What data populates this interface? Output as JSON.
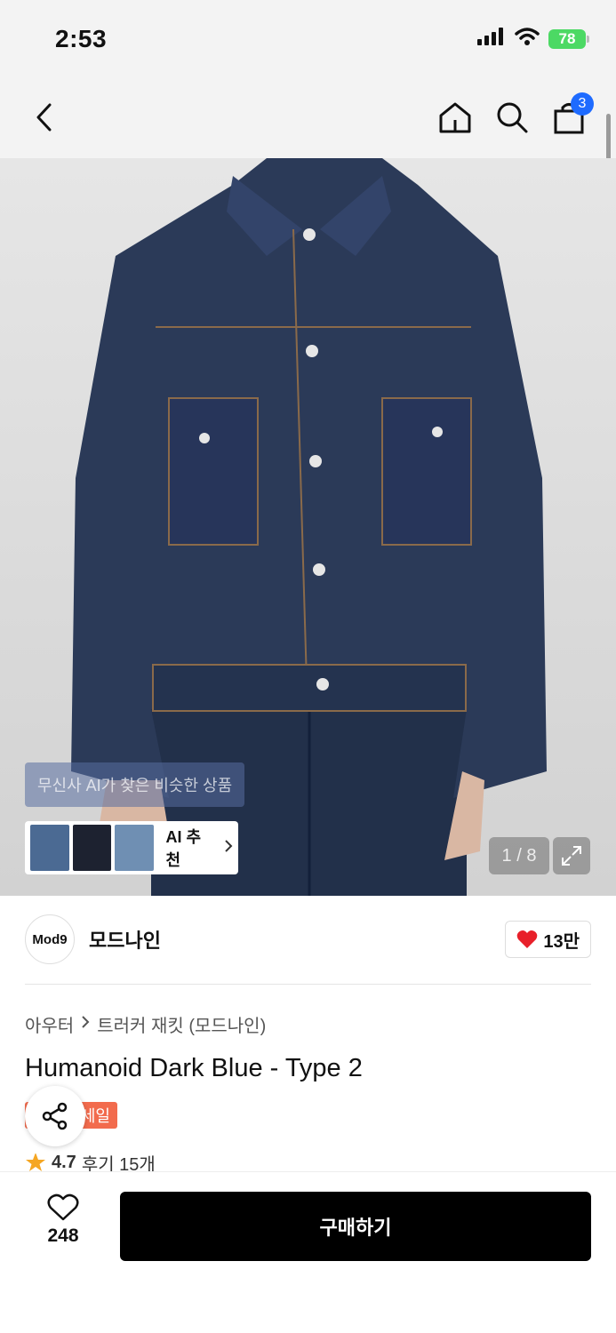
{
  "status_bar": {
    "time": "2:53",
    "battery": "78"
  },
  "nav": {
    "cart_count": "3"
  },
  "gallery": {
    "ai_tooltip": "무신사 AI가 찾은 비슷한 상품",
    "ai_recommend_label": "AI 추천",
    "counter": "1 / 8"
  },
  "brand": {
    "logo_text": "Mod9",
    "name": "모드나인",
    "likes": "13만"
  },
  "breadcrumb": {
    "category": "아우터",
    "subcategory": "트러커 재킷 (모드나인)"
  },
  "product": {
    "title": "Humanoid Dark Blue - Type 2",
    "sale_tag": "세일"
  },
  "rating": {
    "score": "4.7",
    "reviews": "후기 15개"
  },
  "bottom": {
    "wish_count": "248",
    "buy_label": "구매하기"
  },
  "colors": {
    "accent_blue": "#1e6bff",
    "buy_black": "#000000",
    "heart_red": "#e8202a",
    "sale_orange": "#f26b4d",
    "star_orange": "#f5a623"
  }
}
